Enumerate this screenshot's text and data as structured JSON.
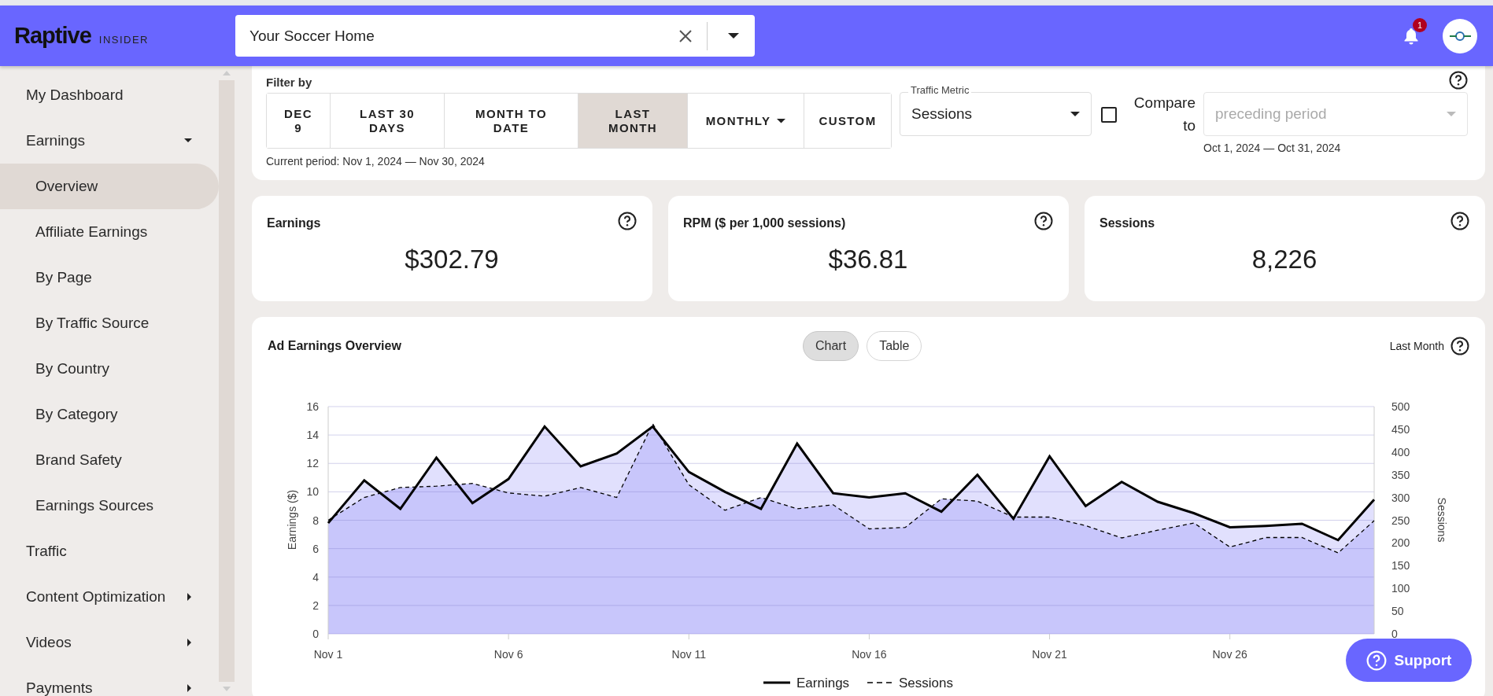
{
  "header": {
    "logo": "Raptive",
    "logo_suffix": "INSIDER",
    "site_select": {
      "value": "Your Soccer Home"
    },
    "notifications": {
      "count": "1"
    }
  },
  "sidebar": {
    "items": [
      {
        "label": "My Dashboard",
        "kind": "link",
        "selected": false
      },
      {
        "label": "Earnings",
        "kind": "group",
        "expanded": true,
        "selected": false,
        "children": [
          {
            "label": "Overview",
            "selected": true
          },
          {
            "label": "Affiliate Earnings",
            "selected": false
          },
          {
            "label": "By Page",
            "selected": false
          },
          {
            "label": "By Traffic Source",
            "selected": false
          },
          {
            "label": "By Country",
            "selected": false
          },
          {
            "label": "By Category",
            "selected": false
          },
          {
            "label": "Brand Safety",
            "selected": false
          },
          {
            "label": "Earnings Sources",
            "selected": false
          }
        ]
      },
      {
        "label": "Traffic",
        "kind": "link",
        "selected": false
      },
      {
        "label": "Content Optimization",
        "kind": "group",
        "expanded": false,
        "selected": false
      },
      {
        "label": "Videos",
        "kind": "group",
        "expanded": false,
        "selected": false
      },
      {
        "label": "Payments",
        "kind": "group",
        "expanded": false,
        "selected": false
      }
    ]
  },
  "filter": {
    "title": "Filter by",
    "periods": [
      {
        "label": "DEC 9",
        "kind": "button",
        "selected": false
      },
      {
        "label": "LAST 30 DAYS",
        "kind": "button",
        "selected": false
      },
      {
        "label": "MONTH TO DATE",
        "kind": "button",
        "selected": false
      },
      {
        "label": "LAST MONTH",
        "kind": "button",
        "selected": true
      },
      {
        "label": "MONTHLY",
        "kind": "dropdown",
        "selected": false
      },
      {
        "label": "CUSTOM",
        "kind": "button",
        "selected": false
      }
    ],
    "current_period": "Current period: Nov 1, 2024 — Nov 30, 2024",
    "traffic_metric": {
      "label": "Traffic Metric",
      "value": "Sessions"
    },
    "compare": {
      "label": "Compare to",
      "checked": false,
      "placeholder": "preceding period",
      "disabled": true,
      "range": "Oct 1, 2024 — Oct 31, 2024"
    }
  },
  "stats": [
    {
      "title": "Earnings",
      "value": "$302.79"
    },
    {
      "title": "RPM ($ per 1,000 sessions)",
      "value": "$36.81"
    },
    {
      "title": "Sessions",
      "value": "8,226"
    }
  ],
  "overview": {
    "title": "Ad Earnings Overview",
    "views": [
      {
        "label": "Chart",
        "selected": true
      },
      {
        "label": "Table",
        "selected": false
      }
    ],
    "period": "Last Month",
    "chart_data": {
      "type": "area",
      "ylabel": "Earnings ($)",
      "y2label": "Sessions",
      "grid": true,
      "legend": true,
      "categories": [
        "Nov 1",
        null,
        null,
        null,
        null,
        "Nov 6",
        null,
        null,
        null,
        null,
        "Nov 11",
        null,
        null,
        null,
        null,
        "Nov 16",
        null,
        null,
        null,
        null,
        "Nov 21",
        null,
        null,
        null,
        null,
        "Nov 26",
        null,
        null,
        null,
        null
      ],
      "ylim": [
        0,
        16
      ],
      "yticks": [
        0,
        2,
        4,
        6,
        8,
        10,
        12,
        14,
        16
      ],
      "y2lim": [
        0,
        500
      ],
      "y2ticks": [
        0,
        50,
        100,
        150,
        200,
        250,
        300,
        350,
        400,
        450,
        500
      ],
      "series": [
        {
          "name": "Earnings",
          "color": "#000000",
          "values": [
            7.8,
            10.8,
            8.8,
            12.4,
            9.2,
            10.9,
            14.6,
            11.8,
            12.7,
            14.6,
            11.4,
            10.0,
            8.8,
            13.4,
            9.9,
            9.6,
            9.9,
            8.6,
            11.2,
            8.1,
            12.5,
            9.0,
            10.7,
            9.3,
            8.5,
            7.5,
            7.6,
            7.75,
            6.6,
            9.45
          ]
        },
        {
          "name": "Sessions",
          "color": "#000000",
          "axis": "y2",
          "values": [
            250,
            300,
            322,
            325,
            331,
            310,
            303,
            322,
            300,
            462,
            328,
            272,
            300,
            275,
            284,
            231,
            234,
            297,
            292,
            257,
            257,
            238,
            211,
            228,
            244,
            191,
            212,
            212,
            178,
            249
          ]
        }
      ]
    }
  },
  "support": {
    "label": "Support"
  }
}
